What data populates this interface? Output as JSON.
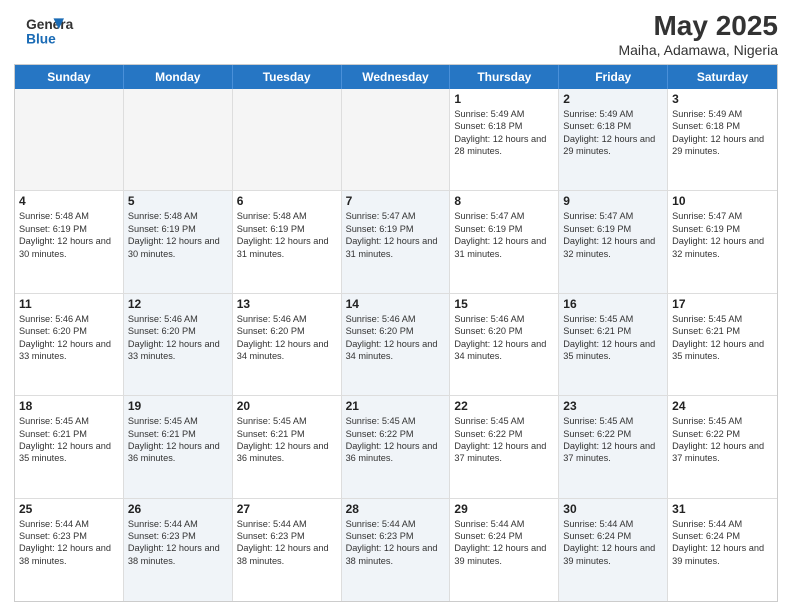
{
  "header": {
    "logo_text_general": "General",
    "logo_text_blue": "Blue",
    "month": "May 2025",
    "location": "Maiha, Adamawa, Nigeria"
  },
  "weekdays": [
    "Sunday",
    "Monday",
    "Tuesday",
    "Wednesday",
    "Thursday",
    "Friday",
    "Saturday"
  ],
  "weeks": [
    [
      {
        "day": "",
        "info": "",
        "empty": true
      },
      {
        "day": "",
        "info": "",
        "empty": true
      },
      {
        "day": "",
        "info": "",
        "empty": true
      },
      {
        "day": "",
        "info": "",
        "empty": true
      },
      {
        "day": "1",
        "info": "Sunrise: 5:49 AM\nSunset: 6:18 PM\nDaylight: 12 hours\nand 28 minutes.",
        "empty": false,
        "shaded": false
      },
      {
        "day": "2",
        "info": "Sunrise: 5:49 AM\nSunset: 6:18 PM\nDaylight: 12 hours\nand 29 minutes.",
        "empty": false,
        "shaded": true
      },
      {
        "day": "3",
        "info": "Sunrise: 5:49 AM\nSunset: 6:18 PM\nDaylight: 12 hours\nand 29 minutes.",
        "empty": false,
        "shaded": false
      }
    ],
    [
      {
        "day": "4",
        "info": "Sunrise: 5:48 AM\nSunset: 6:19 PM\nDaylight: 12 hours\nand 30 minutes.",
        "empty": false,
        "shaded": false
      },
      {
        "day": "5",
        "info": "Sunrise: 5:48 AM\nSunset: 6:19 PM\nDaylight: 12 hours\nand 30 minutes.",
        "empty": false,
        "shaded": true
      },
      {
        "day": "6",
        "info": "Sunrise: 5:48 AM\nSunset: 6:19 PM\nDaylight: 12 hours\nand 31 minutes.",
        "empty": false,
        "shaded": false
      },
      {
        "day": "7",
        "info": "Sunrise: 5:47 AM\nSunset: 6:19 PM\nDaylight: 12 hours\nand 31 minutes.",
        "empty": false,
        "shaded": true
      },
      {
        "day": "8",
        "info": "Sunrise: 5:47 AM\nSunset: 6:19 PM\nDaylight: 12 hours\nand 31 minutes.",
        "empty": false,
        "shaded": false
      },
      {
        "day": "9",
        "info": "Sunrise: 5:47 AM\nSunset: 6:19 PM\nDaylight: 12 hours\nand 32 minutes.",
        "empty": false,
        "shaded": true
      },
      {
        "day": "10",
        "info": "Sunrise: 5:47 AM\nSunset: 6:19 PM\nDaylight: 12 hours\nand 32 minutes.",
        "empty": false,
        "shaded": false
      }
    ],
    [
      {
        "day": "11",
        "info": "Sunrise: 5:46 AM\nSunset: 6:20 PM\nDaylight: 12 hours\nand 33 minutes.",
        "empty": false,
        "shaded": false
      },
      {
        "day": "12",
        "info": "Sunrise: 5:46 AM\nSunset: 6:20 PM\nDaylight: 12 hours\nand 33 minutes.",
        "empty": false,
        "shaded": true
      },
      {
        "day": "13",
        "info": "Sunrise: 5:46 AM\nSunset: 6:20 PM\nDaylight: 12 hours\nand 34 minutes.",
        "empty": false,
        "shaded": false
      },
      {
        "day": "14",
        "info": "Sunrise: 5:46 AM\nSunset: 6:20 PM\nDaylight: 12 hours\nand 34 minutes.",
        "empty": false,
        "shaded": true
      },
      {
        "day": "15",
        "info": "Sunrise: 5:46 AM\nSunset: 6:20 PM\nDaylight: 12 hours\nand 34 minutes.",
        "empty": false,
        "shaded": false
      },
      {
        "day": "16",
        "info": "Sunrise: 5:45 AM\nSunset: 6:21 PM\nDaylight: 12 hours\nand 35 minutes.",
        "empty": false,
        "shaded": true
      },
      {
        "day": "17",
        "info": "Sunrise: 5:45 AM\nSunset: 6:21 PM\nDaylight: 12 hours\nand 35 minutes.",
        "empty": false,
        "shaded": false
      }
    ],
    [
      {
        "day": "18",
        "info": "Sunrise: 5:45 AM\nSunset: 6:21 PM\nDaylight: 12 hours\nand 35 minutes.",
        "empty": false,
        "shaded": false
      },
      {
        "day": "19",
        "info": "Sunrise: 5:45 AM\nSunset: 6:21 PM\nDaylight: 12 hours\nand 36 minutes.",
        "empty": false,
        "shaded": true
      },
      {
        "day": "20",
        "info": "Sunrise: 5:45 AM\nSunset: 6:21 PM\nDaylight: 12 hours\nand 36 minutes.",
        "empty": false,
        "shaded": false
      },
      {
        "day": "21",
        "info": "Sunrise: 5:45 AM\nSunset: 6:22 PM\nDaylight: 12 hours\nand 36 minutes.",
        "empty": false,
        "shaded": true
      },
      {
        "day": "22",
        "info": "Sunrise: 5:45 AM\nSunset: 6:22 PM\nDaylight: 12 hours\nand 37 minutes.",
        "empty": false,
        "shaded": false
      },
      {
        "day": "23",
        "info": "Sunrise: 5:45 AM\nSunset: 6:22 PM\nDaylight: 12 hours\nand 37 minutes.",
        "empty": false,
        "shaded": true
      },
      {
        "day": "24",
        "info": "Sunrise: 5:45 AM\nSunset: 6:22 PM\nDaylight: 12 hours\nand 37 minutes.",
        "empty": false,
        "shaded": false
      }
    ],
    [
      {
        "day": "25",
        "info": "Sunrise: 5:44 AM\nSunset: 6:23 PM\nDaylight: 12 hours\nand 38 minutes.",
        "empty": false,
        "shaded": false
      },
      {
        "day": "26",
        "info": "Sunrise: 5:44 AM\nSunset: 6:23 PM\nDaylight: 12 hours\nand 38 minutes.",
        "empty": false,
        "shaded": true
      },
      {
        "day": "27",
        "info": "Sunrise: 5:44 AM\nSunset: 6:23 PM\nDaylight: 12 hours\nand 38 minutes.",
        "empty": false,
        "shaded": false
      },
      {
        "day": "28",
        "info": "Sunrise: 5:44 AM\nSunset: 6:23 PM\nDaylight: 12 hours\nand 38 minutes.",
        "empty": false,
        "shaded": true
      },
      {
        "day": "29",
        "info": "Sunrise: 5:44 AM\nSunset: 6:24 PM\nDaylight: 12 hours\nand 39 minutes.",
        "empty": false,
        "shaded": false
      },
      {
        "day": "30",
        "info": "Sunrise: 5:44 AM\nSunset: 6:24 PM\nDaylight: 12 hours\nand 39 minutes.",
        "empty": false,
        "shaded": true
      },
      {
        "day": "31",
        "info": "Sunrise: 5:44 AM\nSunset: 6:24 PM\nDaylight: 12 hours\nand 39 minutes.",
        "empty": false,
        "shaded": false
      }
    ]
  ]
}
